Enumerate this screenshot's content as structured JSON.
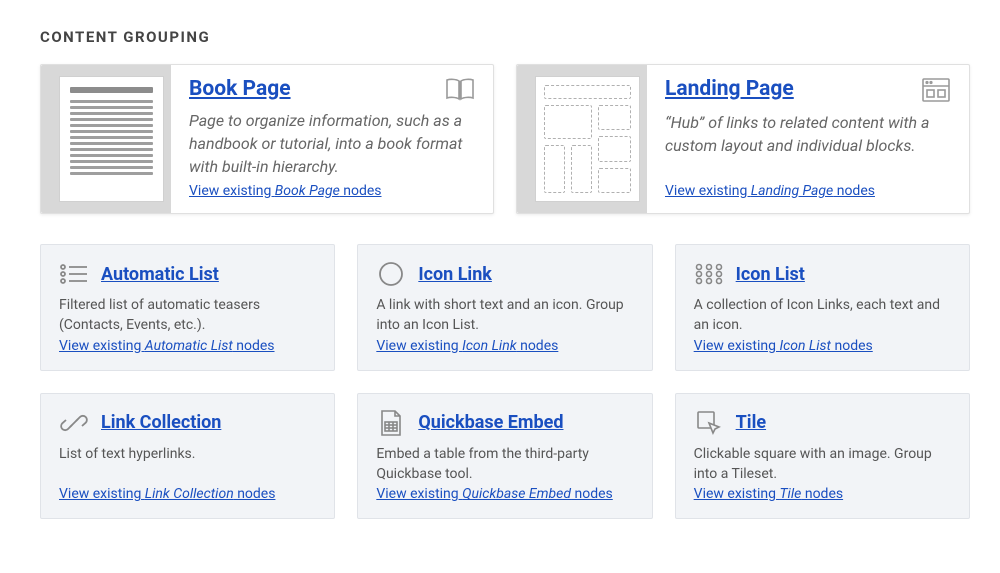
{
  "section_title": "CONTENT GROUPING",
  "featured": [
    {
      "title": "Book Page",
      "desc": "Page to organize information, such as a handbook or tutorial, into a book format with built-in hierarchy.",
      "view_prefix": "View existing ",
      "view_em": "Book Page",
      "view_suffix": " nodes",
      "icon": "book-open-icon",
      "thumb": "document"
    },
    {
      "title": "Landing Page",
      "desc": "“Hub” of links to related content with a custom layout and individual blocks.",
      "view_prefix": "View existing ",
      "view_em": "Landing Page",
      "view_suffix": " nodes",
      "icon": "layout-icon",
      "thumb": "landing"
    }
  ],
  "cards": [
    {
      "title": "Automatic List",
      "desc": "Filtered list of automatic teasers (Contacts, Events, etc.).",
      "view_prefix": "View existing ",
      "view_em": "Automatic List",
      "view_suffix": " nodes",
      "icon": "bullet-list-icon"
    },
    {
      "title": "Icon Link",
      "desc": "A link with short text and an icon. Group into an Icon List.",
      "view_prefix": "View existing ",
      "view_em": "Icon Link",
      "view_suffix": " nodes",
      "icon": "circle-icon"
    },
    {
      "title": "Icon List",
      "desc": "A collection of Icon Links, each text and an icon.",
      "view_prefix": "View existing ",
      "view_em": "Icon List",
      "view_suffix": " nodes",
      "icon": "dots-grid-icon"
    },
    {
      "title": "Link Collection",
      "desc": "List of text hyperlinks.",
      "view_prefix": "View existing ",
      "view_em": "Link Collection",
      "view_suffix": " nodes",
      "icon": "chain-link-icon"
    },
    {
      "title": "Quickbase Embed",
      "desc": "Embed a table from the third-party Quickbase tool.",
      "view_prefix": "View existing ",
      "view_em": "Quickbase Embed",
      "view_suffix": " nodes",
      "icon": "table-file-icon"
    },
    {
      "title": "Tile",
      "desc": "Clickable square with an image. Group into a Tileset.",
      "view_prefix": "View existing ",
      "view_em": "Tile",
      "view_suffix": " nodes",
      "icon": "cursor-box-icon"
    }
  ]
}
